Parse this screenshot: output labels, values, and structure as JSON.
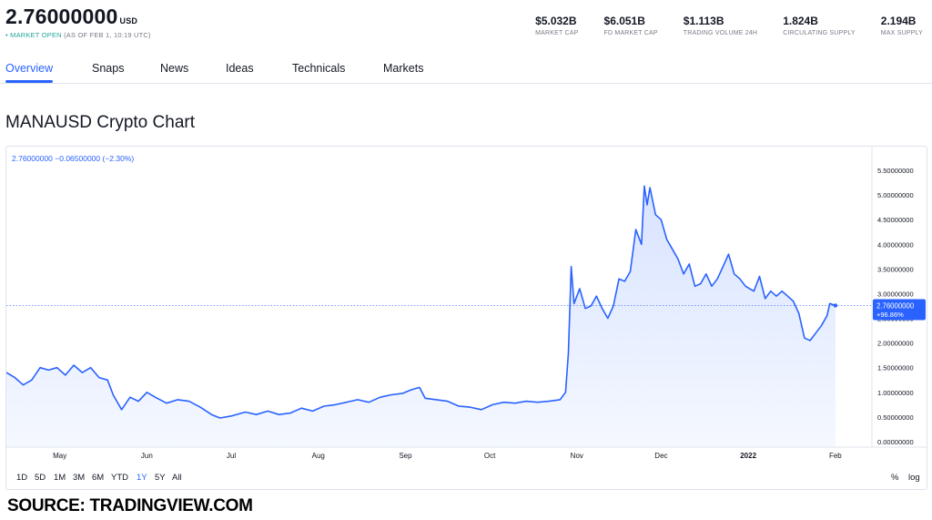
{
  "header": {
    "price": "2.76000000",
    "price_unit": "USD",
    "status_dot": "•",
    "status_open": "MARKET OPEN",
    "status_time": "(AS OF FEB 1, 10:19 UTC)"
  },
  "stats": [
    {
      "value": "$5.032B",
      "label": "MARKET CAP"
    },
    {
      "value": "$6.051B",
      "label": "FD MARKET CAP"
    },
    {
      "value": "$1.113B",
      "label": "TRADING VOLUME 24H"
    },
    {
      "value": "1.824B",
      "label": "CIRCULATING SUPPLY"
    },
    {
      "value": "2.194B",
      "label": "MAX SUPPLY"
    }
  ],
  "tabs": [
    "Overview",
    "Snaps",
    "News",
    "Ideas",
    "Technicals",
    "Markets"
  ],
  "active_tab": "Overview",
  "chart_heading": "MANAUSD Crypto Chart",
  "legend_text": "2.76000000  −0.06500000 (−2.30%)",
  "price_label": "2.76000000",
  "change_label": "+96.86%",
  "range_buttons": [
    "1D",
    "5D",
    "1M",
    "3M",
    "6M",
    "YTD",
    "1Y",
    "5Y",
    "All"
  ],
  "active_range": "1Y",
  "scale_buttons": [
    "%",
    "log"
  ],
  "source": "SOURCE: TRADINGVIEW.COM",
  "colors": {
    "line": "#2962ff",
    "accent": "#2962ff",
    "positive": "#26a69a",
    "fill_top": "#d8e3ff",
    "fill_bottom": "#f5f8ff",
    "text": "#131722",
    "muted": "#787b86",
    "grid_border": "#e0e3eb"
  },
  "chart_data": {
    "type": "area",
    "title": "",
    "xlabel": "",
    "ylabel": "",
    "ylim": [
      0,
      5.5
    ],
    "y_ticks": [
      "0.00000000",
      "0.50000000",
      "1.00000000",
      "1.50000000",
      "2.00000000",
      "2.50000000",
      "3.00000000",
      "3.50000000",
      "4.00000000",
      "4.50000000",
      "5.00000000",
      "5.50000000"
    ],
    "y_tick_values": [
      0,
      0.5,
      1,
      1.5,
      2,
      2.5,
      3,
      3.5,
      4,
      4.5,
      5,
      5.5
    ],
    "x_ticks": [
      {
        "label": "May",
        "date": "2021-05-01",
        "bold": false
      },
      {
        "label": "Jun",
        "date": "2021-06-01",
        "bold": false
      },
      {
        "label": "Jul",
        "date": "2021-07-01",
        "bold": false
      },
      {
        "label": "Aug",
        "date": "2021-08-01",
        "bold": false
      },
      {
        "label": "Sep",
        "date": "2021-09-01",
        "bold": false
      },
      {
        "label": "Oct",
        "date": "2021-10-01",
        "bold": false
      },
      {
        "label": "Nov",
        "date": "2021-11-01",
        "bold": false
      },
      {
        "label": "Dec",
        "date": "2021-12-01",
        "bold": false
      },
      {
        "label": "2022",
        "date": "2022-01-01",
        "bold": true
      },
      {
        "label": "Feb",
        "date": "2022-02-01",
        "bold": false
      }
    ],
    "xlim": [
      "2021-04-12",
      "2022-02-14"
    ],
    "last_value": 2.76,
    "series": [
      {
        "points": [
          [
            "2021-04-12",
            1.4
          ],
          [
            "2021-04-15",
            1.3
          ],
          [
            "2021-04-18",
            1.15
          ],
          [
            "2021-04-21",
            1.25
          ],
          [
            "2021-04-24",
            1.5
          ],
          [
            "2021-04-27",
            1.45
          ],
          [
            "2021-04-30",
            1.5
          ],
          [
            "2021-05-03",
            1.35
          ],
          [
            "2021-05-06",
            1.55
          ],
          [
            "2021-05-09",
            1.4
          ],
          [
            "2021-05-12",
            1.5
          ],
          [
            "2021-05-15",
            1.3
          ],
          [
            "2021-05-18",
            1.25
          ],
          [
            "2021-05-20",
            0.95
          ],
          [
            "2021-05-23",
            0.65
          ],
          [
            "2021-05-26",
            0.9
          ],
          [
            "2021-05-29",
            0.82
          ],
          [
            "2021-06-01",
            1.0
          ],
          [
            "2021-06-04",
            0.9
          ],
          [
            "2021-06-08",
            0.78
          ],
          [
            "2021-06-12",
            0.85
          ],
          [
            "2021-06-16",
            0.82
          ],
          [
            "2021-06-20",
            0.7
          ],
          [
            "2021-06-24",
            0.55
          ],
          [
            "2021-06-27",
            0.48
          ],
          [
            "2021-07-01",
            0.52
          ],
          [
            "2021-07-06",
            0.6
          ],
          [
            "2021-07-10",
            0.55
          ],
          [
            "2021-07-14",
            0.62
          ],
          [
            "2021-07-18",
            0.55
          ],
          [
            "2021-07-22",
            0.58
          ],
          [
            "2021-07-26",
            0.68
          ],
          [
            "2021-07-30",
            0.62
          ],
          [
            "2021-08-03",
            0.72
          ],
          [
            "2021-08-07",
            0.75
          ],
          [
            "2021-08-11",
            0.8
          ],
          [
            "2021-08-15",
            0.85
          ],
          [
            "2021-08-19",
            0.8
          ],
          [
            "2021-08-23",
            0.9
          ],
          [
            "2021-08-27",
            0.95
          ],
          [
            "2021-08-31",
            0.98
          ],
          [
            "2021-09-03",
            1.05
          ],
          [
            "2021-09-06",
            1.1
          ],
          [
            "2021-09-08",
            0.88
          ],
          [
            "2021-09-12",
            0.85
          ],
          [
            "2021-09-16",
            0.82
          ],
          [
            "2021-09-20",
            0.72
          ],
          [
            "2021-09-24",
            0.7
          ],
          [
            "2021-09-28",
            0.65
          ],
          [
            "2021-10-02",
            0.75
          ],
          [
            "2021-10-06",
            0.8
          ],
          [
            "2021-10-10",
            0.78
          ],
          [
            "2021-10-14",
            0.82
          ],
          [
            "2021-10-18",
            0.8
          ],
          [
            "2021-10-22",
            0.82
          ],
          [
            "2021-10-26",
            0.85
          ],
          [
            "2021-10-28",
            1.0
          ],
          [
            "2021-10-29",
            1.8
          ],
          [
            "2021-10-30",
            3.55
          ],
          [
            "2021-10-31",
            2.8
          ],
          [
            "2021-11-02",
            3.1
          ],
          [
            "2021-11-04",
            2.7
          ],
          [
            "2021-11-06",
            2.75
          ],
          [
            "2021-11-08",
            2.95
          ],
          [
            "2021-11-10",
            2.7
          ],
          [
            "2021-11-12",
            2.5
          ],
          [
            "2021-11-14",
            2.75
          ],
          [
            "2021-11-16",
            3.3
          ],
          [
            "2021-11-18",
            3.25
          ],
          [
            "2021-11-20",
            3.45
          ],
          [
            "2021-11-22",
            4.3
          ],
          [
            "2021-11-24",
            4.0
          ],
          [
            "2021-11-25",
            5.18
          ],
          [
            "2021-11-26",
            4.8
          ],
          [
            "2021-11-27",
            5.15
          ],
          [
            "2021-11-29",
            4.6
          ],
          [
            "2021-12-01",
            4.5
          ],
          [
            "2021-12-03",
            4.1
          ],
          [
            "2021-12-05",
            3.9
          ],
          [
            "2021-12-07",
            3.7
          ],
          [
            "2021-12-09",
            3.4
          ],
          [
            "2021-12-11",
            3.6
          ],
          [
            "2021-12-13",
            3.15
          ],
          [
            "2021-12-15",
            3.2
          ],
          [
            "2021-12-17",
            3.4
          ],
          [
            "2021-12-19",
            3.15
          ],
          [
            "2021-12-21",
            3.3
          ],
          [
            "2021-12-23",
            3.55
          ],
          [
            "2021-12-25",
            3.8
          ],
          [
            "2021-12-27",
            3.4
          ],
          [
            "2021-12-29",
            3.3
          ],
          [
            "2021-12-31",
            3.15
          ],
          [
            "2022-01-03",
            3.05
          ],
          [
            "2022-01-05",
            3.35
          ],
          [
            "2022-01-07",
            2.9
          ],
          [
            "2022-01-09",
            3.05
          ],
          [
            "2022-01-11",
            2.95
          ],
          [
            "2022-01-13",
            3.05
          ],
          [
            "2022-01-15",
            2.95
          ],
          [
            "2022-01-17",
            2.85
          ],
          [
            "2022-01-19",
            2.6
          ],
          [
            "2022-01-21",
            2.1
          ],
          [
            "2022-01-23",
            2.05
          ],
          [
            "2022-01-25",
            2.2
          ],
          [
            "2022-01-27",
            2.35
          ],
          [
            "2022-01-29",
            2.55
          ],
          [
            "2022-01-30",
            2.8
          ],
          [
            "2022-02-01",
            2.76
          ]
        ]
      }
    ]
  }
}
